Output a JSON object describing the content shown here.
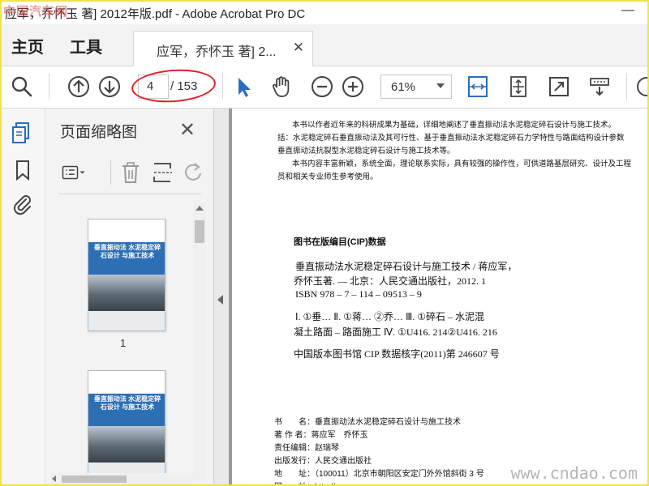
{
  "window": {
    "title": "应军，乔怀玉 著] 2012年版.pdf - Adobe Acrobat Pro DC",
    "watermark": "中国汽车网",
    "minimize": "—"
  },
  "menu": {
    "home": "主页",
    "tools": "工具",
    "doc_tab": "应军，乔怀玉 著] 2...",
    "tab_close": "✕"
  },
  "toolbar": {
    "page_current": "4",
    "page_total": "/ 153",
    "zoom": "61%"
  },
  "nav_rail": {
    "icons": [
      "page-thumbnails-icon",
      "bookmark-icon",
      "attachment-icon"
    ]
  },
  "thumbnail_panel": {
    "title": "页面缩略图",
    "close": "✕",
    "cover_title": "垂直振动法 水泥稳定碎石设计 与施工技术",
    "page_labels": [
      "1"
    ]
  },
  "document": {
    "intro_lines": [
      "本书以作者近年来的科研成果为基础，详细地阐述了垂直振动法水泥稳定碎石设计与施工技术。",
      "括：水泥稳定碎石垂直振动法及其可行性、基于垂直振动法水泥稳定碎石力学特性与路面结构设计参数",
      "垂直振动法抗裂型水泥稳定碎石设计与施工技术等。",
      "本书内容丰富新颖，系统全面，理论联系实际，具有较强的操作性，可供道路基层研究、设计及工程",
      "员和相关专业师生参考使用。"
    ],
    "cip_heading": "图书在版编目(CIP)数据",
    "cip_lines": [
      "垂直振动法水泥稳定碎石设计与施工技术 / 蒋应军，",
      "乔怀玉著. — 北京：人民交通出版社，2012. 1",
      "ISBN 978 – 7 – 114 – 09513 – 9",
      "Ⅰ. ①垂… Ⅱ. ①蒋… ②乔… Ⅲ. ①碎石 – 水泥混",
      "凝土路面 – 路面施工 Ⅳ. ①U416. 214②U416. 216",
      "中国版本图书馆 CIP 数据核字(2011)第 246607 号"
    ],
    "colophon_lines": [
      "书　　名：垂直振动法水泥稳定碎石设计与施工技术",
      "著 作 者：蒋应军　乔怀玉",
      "责任编辑：赵瑞琴",
      "出版发行：人民交通出版社",
      "地　　址：（100011）北京市朝阳区安定门外外馆斜街 3 号",
      "网　　址：http://www.ccpress.com.cn"
    ],
    "watermark": "www.cndao.com"
  },
  "colors": {
    "annotation_ring": "#e0202a",
    "accent": "#2b6cc4",
    "frame": "#f0e24a"
  }
}
